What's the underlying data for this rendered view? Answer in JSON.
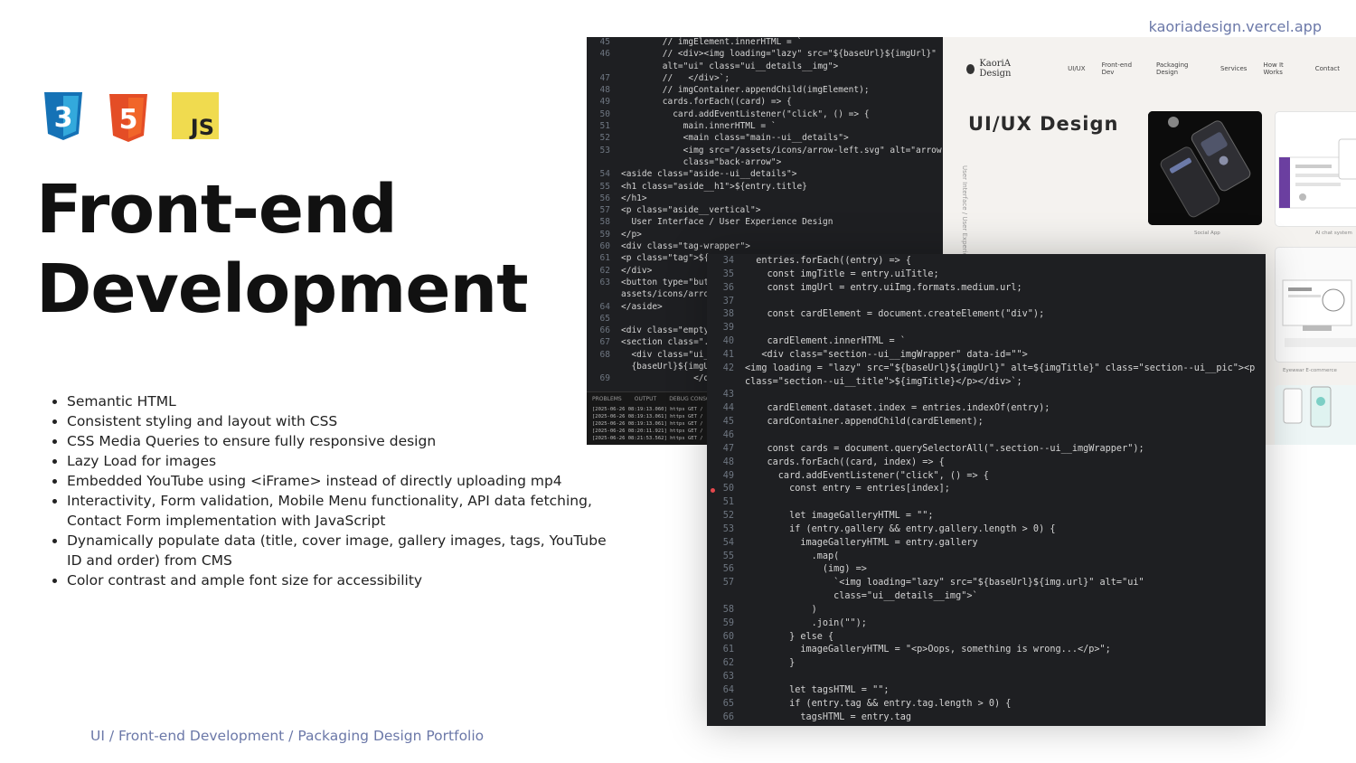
{
  "site_link": "kaoriadesign.vercel.app",
  "logos": {
    "css": "3",
    "html": "5",
    "js": "JS"
  },
  "title": {
    "line1": "Front-end",
    "line2": "Development"
  },
  "features": [
    "Semantic HTML",
    "Consistent styling and layout with CSS",
    "CSS Media Queries to ensure fully responsive design",
    "Lazy Load for images",
    "Embedded YouTube using <iFrame> instead of directly uploading mp4",
    "Interactivity, Form validation, Mobile Menu functionality, API data fetching, Contact Form implementation with JavaScript",
    "Dynamically populate data (title, cover image, gallery images, tags, YouTube ID and order) from CMS",
    "Color contrast and ample font size for accessibility"
  ],
  "footer": "UI / Front-end Development / Packaging Design Portfolio",
  "editor_back": {
    "lines": [
      {
        "n": "45",
        "t": "        // imgElement.innerHTML = `"
      },
      {
        "n": "46",
        "t": "        // <div><img loading=\"lazy\" src=\"${baseUrl}${imgUrl}\""
      },
      {
        "n": "",
        "t": "        alt=\"ui\" class=\"ui__details__img\">"
      },
      {
        "n": "47",
        "t": "        //   </div>`;"
      },
      {
        "n": "48",
        "t": "        // imgContainer.appendChild(imgElement);"
      },
      {
        "n": "49",
        "t": "        cards.forEach((card) => {"
      },
      {
        "n": "50",
        "t": "          card.addEventListener(\"click\", () => {"
      },
      {
        "n": "51",
        "t": "            main.innerHTML = `"
      },
      {
        "n": "52",
        "t": "            <main class=\"main--ui__details\">"
      },
      {
        "n": "53",
        "t": "            <img src=\"/assets/icons/arrow-left.svg\" alt=\"arrow\""
      },
      {
        "n": "",
        "t": "            class=\"back-arrow\">"
      },
      {
        "n": "54",
        "t": "<aside class=\"aside--ui__details\">"
      },
      {
        "n": "55",
        "t": "<h1 class=\"aside__h1\">${entry.title}"
      },
      {
        "n": "56",
        "t": "</h1>"
      },
      {
        "n": "57",
        "t": "<p class=\"aside__vertical\">"
      },
      {
        "n": "58",
        "t": "  User Interface / User Experience Design"
      },
      {
        "n": "59",
        "t": "</p>"
      },
      {
        "n": "60",
        "t": "<div class=\"tag-wrapper\">"
      },
      {
        "n": "61",
        "t": "<p class=\"tag\">${e"
      },
      {
        "n": "62",
        "t": "</div>"
      },
      {
        "n": "63",
        "t": "<button type=\"butt"
      },
      {
        "n": "",
        "t": "assets/icons/arrow"
      },
      {
        "n": "64",
        "t": "</aside>"
      },
      {
        "n": "65",
        "t": ""
      },
      {
        "n": "66",
        "t": "<div class=\"empty\""
      },
      {
        "n": "67",
        "t": "<section class=\".s"
      },
      {
        "n": "68",
        "t": "  <div class=\"ui__"
      },
      {
        "n": "",
        "t": "  {baseUrl}${imgUr"
      },
      {
        "n": "69",
        "t": "              </div>"
      }
    ],
    "panel_tabs": [
      "PROBLEMS",
      "OUTPUT",
      "DEBUG CONSOLE"
    ],
    "panel_log": [
      "[2025-06-26 08:19:13.060] https GET /",
      "[2025-06-26 08:19:13.061] https GET /",
      "[2025-06-26 08:19:13.061] https GET /",
      "[2025-06-26 08:20:11.921] https GET /",
      "[2025-06-26 08:21:53.562] https GET /"
    ]
  },
  "preview": {
    "brand": "KaoriA Design",
    "nav": [
      "UI/UX",
      "Front-end Dev",
      "Packaging Design",
      "Services",
      "How It Works",
      "Contact"
    ],
    "heading": "UI/UX Design",
    "vertical": "User Interface / User Experience",
    "captions": {
      "social": "Social App",
      "ai": "AI chat system",
      "eyewear": "Eyewear E-commerce"
    }
  },
  "editor_front": {
    "lines": [
      {
        "n": "34",
        "t": "  entries.forEach((entry) => {"
      },
      {
        "n": "35",
        "t": "    const imgTitle = entry.uiTitle;"
      },
      {
        "n": "36",
        "t": "    const imgUrl = entry.uiImg.formats.medium.url;"
      },
      {
        "n": "37",
        "t": ""
      },
      {
        "n": "38",
        "t": "    const cardElement = document.createElement(\"div\");"
      },
      {
        "n": "39",
        "t": ""
      },
      {
        "n": "40",
        "t": "    cardElement.innerHTML = `"
      },
      {
        "n": "41",
        "t": "   <div class=\"section--ui__imgWrapper\" data-id=\"\">"
      },
      {
        "n": "42",
        "t": "<img loading = \"lazy\" src=\"${baseUrl}${imgUrl}\" alt=${imgTitle}\" class=\"section--ui__pic\"><p"
      },
      {
        "n": "",
        "t": "class=\"section--ui__title\">${imgTitle}</p></div>`;"
      },
      {
        "n": "43",
        "t": ""
      },
      {
        "n": "44",
        "t": "    cardElement.dataset.index = entries.indexOf(entry);"
      },
      {
        "n": "45",
        "t": "    cardContainer.appendChild(cardElement);"
      },
      {
        "n": "46",
        "t": ""
      },
      {
        "n": "47",
        "t": "    const cards = document.querySelectorAll(\".section--ui__imgWrapper\");"
      },
      {
        "n": "48",
        "t": "    cards.forEach((card, index) => {"
      },
      {
        "n": "49",
        "t": "      card.addEventListener(\"click\", () => {"
      },
      {
        "n": "50",
        "t": "        const entry = entries[index];"
      },
      {
        "n": "51",
        "t": ""
      },
      {
        "n": "52",
        "t": "        let imageGalleryHTML = \"\";"
      },
      {
        "n": "53",
        "t": "        if (entry.gallery && entry.gallery.length > 0) {"
      },
      {
        "n": "54",
        "t": "          imageGalleryHTML = entry.gallery"
      },
      {
        "n": "55",
        "t": "            .map("
      },
      {
        "n": "56",
        "t": "              (img) =>"
      },
      {
        "n": "57",
        "t": "                `<img loading=\"lazy\" src=\"${baseUrl}${img.url}\" alt=\"ui\""
      },
      {
        "n": "",
        "t": "                class=\"ui__details__img\">`"
      },
      {
        "n": "58",
        "t": "            )"
      },
      {
        "n": "59",
        "t": "            .join(\"\");"
      },
      {
        "n": "60",
        "t": "        } else {"
      },
      {
        "n": "61",
        "t": "          imageGalleryHTML = \"<p>Oops, something is wrong...</p>\";"
      },
      {
        "n": "62",
        "t": "        }"
      },
      {
        "n": "63",
        "t": ""
      },
      {
        "n": "64",
        "t": "        let tagsHTML = \"\";"
      },
      {
        "n": "65",
        "t": "        if (entry.tag && entry.tag.length > 0) {"
      },
      {
        "n": "66",
        "t": "          tagsHTML = entry.tag"
      }
    ]
  }
}
